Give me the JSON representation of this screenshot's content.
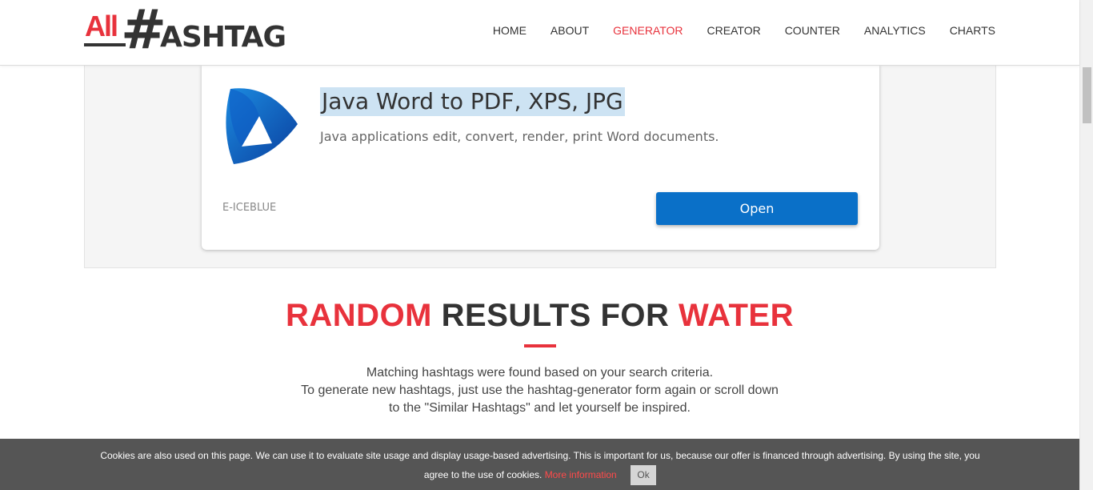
{
  "header": {
    "logo": {
      "all": "All",
      "hash": "#",
      "text": "ASHTAG"
    },
    "nav": [
      {
        "label": "HOME"
      },
      {
        "label": "ABOUT"
      },
      {
        "label": "GENERATOR"
      },
      {
        "label": "CREATOR"
      },
      {
        "label": "COUNTER"
      },
      {
        "label": "ANALYTICS"
      },
      {
        "label": "CHARTS"
      }
    ],
    "active_nav": "GENERATOR"
  },
  "ad": {
    "title": "Java Word to PDF, XPS, JPG",
    "description": "Java applications edit, convert, render, print Word documents.",
    "advertiser": "E-ICEBLUE",
    "button_label": "Open"
  },
  "results": {
    "title_part1": "RANDOM",
    "title_part2": "RESULTS FOR",
    "title_part3": "WATER",
    "line1": "Matching hashtags were found based on your search criteria.",
    "line2": "To generate new hashtags, just use the hashtag-generator form again or scroll down",
    "line3": "to the \"Similar Hashtags\" and let yourself be inspired."
  },
  "cookie": {
    "text": "Cookies are also used on this page. We can use it to evaluate site usage and display usage-based advertising. This is important for us, because our offer is financed through advertising. By using the site, you agree to the use of cookies.",
    "link": "More information",
    "ok_label": "Ok"
  },
  "colors": {
    "accent": "#e8323c",
    "ad_button": "#0a70c8",
    "cookie_bg": "#555555"
  }
}
